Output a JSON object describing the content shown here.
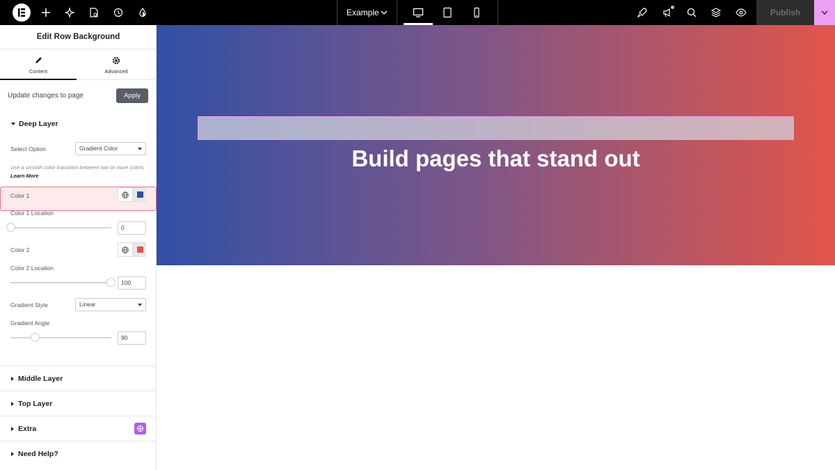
{
  "topbar": {
    "page_name": "Example",
    "publish_label": "Publish"
  },
  "panel": {
    "title": "Edit Row Background",
    "tabs": [
      {
        "label": "Content",
        "icon": "pencil-icon",
        "active": true
      },
      {
        "label": "Advanced",
        "icon": "gear-icon",
        "active": false
      }
    ],
    "update_text": "Update changes to page",
    "apply_label": "Apply",
    "deep_layer": {
      "title": "Deep Layer",
      "select_option_label": "Select Option",
      "select_option_value": "Gradient Color",
      "help_text": "Use a smooth color transition between two or more colors.",
      "learn_more": "Learn More",
      "color1_label": "Color 1",
      "color1_value": "#3150a6",
      "color1_location_label": "Color 1 Location",
      "color1_location": "0",
      "color2_label": "Color 2",
      "color2_value": "#e2554a",
      "color2_location_label": "Color 2 Location",
      "color2_location": "100",
      "gradient_style_label": "Gradient Style",
      "gradient_style_value": "Linear",
      "gradient_angle_label": "Gradient Angle",
      "gradient_angle": "90"
    },
    "sections": [
      {
        "title": "Middle Layer"
      },
      {
        "title": "Top Layer"
      },
      {
        "title": "Extra"
      },
      {
        "title": "Need Help?"
      }
    ]
  },
  "canvas": {
    "heading": "Build pages that stand out"
  }
}
